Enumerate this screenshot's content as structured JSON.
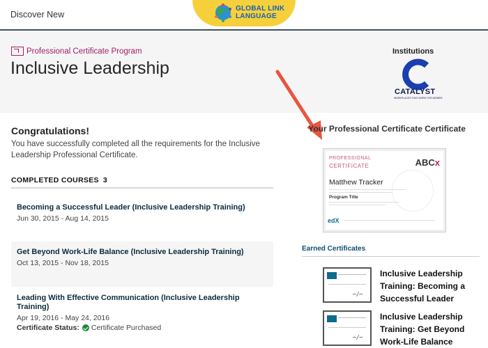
{
  "nav": {
    "discover_label": "Discover New",
    "logo_line1": "GLOBAL LINK",
    "logo_line2": "LANGUAGE"
  },
  "header": {
    "program_label": "Professional Certificate Program",
    "title": "Inclusive Leadership",
    "institutions_label": "Institutions",
    "institution_name": "CATALYST",
    "institution_tagline": "WORKPLACES THAT WORK FOR WOMEN"
  },
  "main": {
    "congrats_title": "Congratulations!",
    "congrats_text": "You have successfully completed all the requirements for the Inclusive Leadership Professional Certificate.",
    "completed_label": "COMPLETED COURSES",
    "completed_count": "3",
    "courses": [
      {
        "title": "Becoming a Successful Leader (Inclusive Leadership Training)",
        "dates": "Jun 30, 2015 - Aug 14, 2015"
      },
      {
        "title": "Get Beyond Work-Life Balance (Inclusive Leadership Training)",
        "dates": "Oct 13, 2015 - Nov 18, 2015"
      },
      {
        "title": "Leading With Effective Communication (Inclusive Leadership Training)",
        "dates": "Apr 19, 2016 - May 24, 2016",
        "status_label": "Certificate Status:",
        "status_value": "Certificate Purchased"
      }
    ]
  },
  "sidebar": {
    "cert_heading": "Your Professional Certificate Certificate",
    "cert": {
      "type_line1": "PROFESSIONAL",
      "type_line2": "CERTIFICATE",
      "org": "ABC",
      "org_x": "x",
      "holder": "Matthew Tracker",
      "program": "Program Title",
      "platform": "edX"
    },
    "earned_heading": "Earned Certificates",
    "earned": [
      {
        "title": "Inclusive Leadership Training: Becoming a Successful Leader"
      },
      {
        "title": "Inclusive Leadership Training: Get Beyond Work-Life Balance"
      }
    ]
  },
  "colors": {
    "accent_magenta": "#a01f6a",
    "nav_rule": "#3d4f5c",
    "logo_yellow": "#f5d03b",
    "link_blue": "#0e4d72",
    "success_green": "#1f8a3a",
    "arrow_red": "#e8553e"
  },
  "icons": [
    "certificate-program-icon",
    "globe-logo-icon",
    "check-circle-icon",
    "annotation-arrow-icon"
  ]
}
